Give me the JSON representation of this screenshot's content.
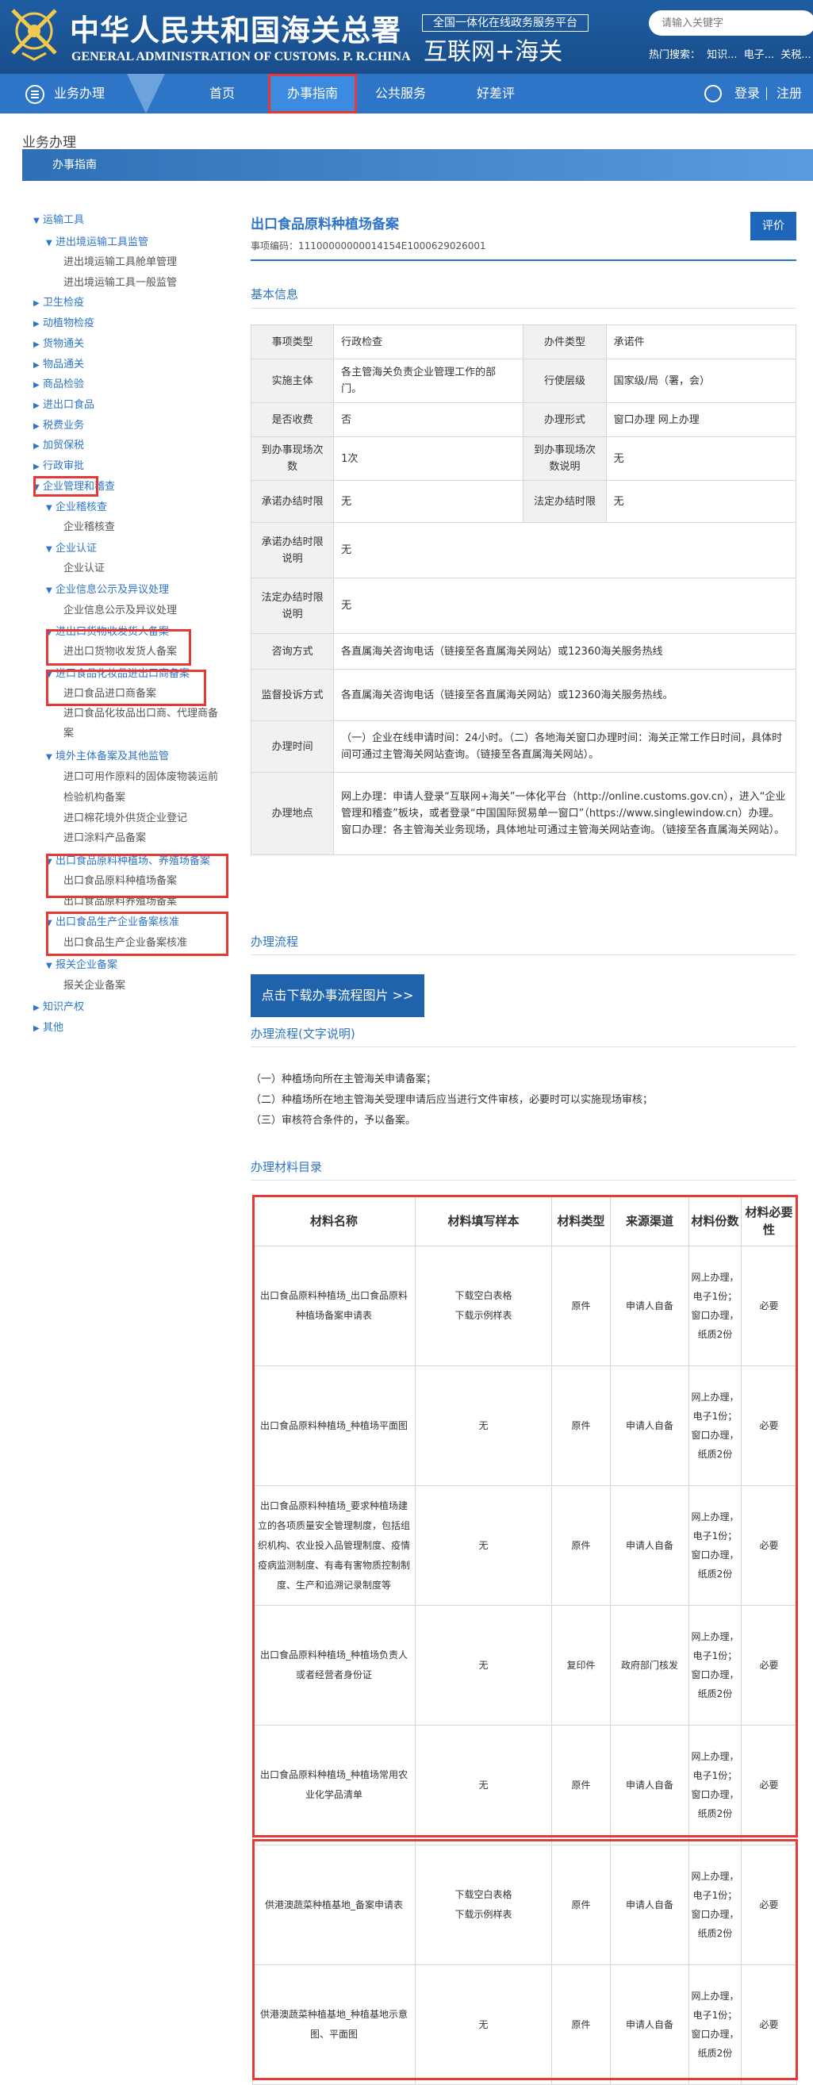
{
  "header": {
    "title_cn": "中华人民共和国海关总署",
    "title_en": "GENERAL ADMINISTRATION OF CUSTOMS. P. R.CHINA",
    "platform_tag": "全国一体化在线政务服务平台",
    "platform_name": "互联网+海关",
    "search_placeholder": "请输入关键字",
    "hot_search_label": "热门搜索：",
    "hot_search_items": [
      "知识...",
      "电子...",
      "关税..."
    ]
  },
  "nav": {
    "business": "业务办理",
    "home": "首页",
    "guide": "办事指南",
    "public_service": "公共服务",
    "review": "好差评",
    "login": "登录",
    "register": "注册"
  },
  "breadcrumb": "业务办理",
  "guide_bar_label": "办事指南",
  "sidebar": {
    "items": [
      {
        "label": "运输工具",
        "level": 0,
        "expanded": true
      },
      {
        "label": "进出境运输工具监管",
        "level": 1,
        "expanded": true
      },
      {
        "label": "进出境运输工具舱单管理",
        "level": 2
      },
      {
        "label": "进出境运输工具一般监管",
        "level": 2
      },
      {
        "label": "卫生检疫",
        "level": 0
      },
      {
        "label": "动植物检疫",
        "level": 0
      },
      {
        "label": "货物通关",
        "level": 0
      },
      {
        "label": "物品通关",
        "level": 0
      },
      {
        "label": "商品检验",
        "level": 0
      },
      {
        "label": "进出口食品",
        "level": 0
      },
      {
        "label": "税费业务",
        "level": 0
      },
      {
        "label": "加贸保税",
        "level": 0
      },
      {
        "label": "行政审批",
        "level": 0
      },
      {
        "label": "企业管理和稽查",
        "level": 0,
        "expanded": true
      },
      {
        "label": "企业稽核查",
        "level": 1,
        "expanded": true
      },
      {
        "label": "企业稽核查",
        "level": 2
      },
      {
        "label": "企业认证",
        "level": 1,
        "expanded": true
      },
      {
        "label": "企业认证",
        "level": 2
      },
      {
        "label": "企业信息公示及异议处理",
        "level": 1,
        "expanded": true
      },
      {
        "label": "企业信息公示及异议处理",
        "level": 2
      },
      {
        "label": "进出口货物收发货人备案",
        "level": 1,
        "expanded": true
      },
      {
        "label": "进出口货物收发货人备案",
        "level": 2
      },
      {
        "label": "进口食品化妆品进出口商备案",
        "level": 1,
        "expanded": true
      },
      {
        "label": "进口食品进口商备案",
        "level": 2
      },
      {
        "label": "进口食品化妆品出口商、代理商备",
        "level": 2
      },
      {
        "label": "案",
        "level": 2
      },
      {
        "label": "境外主体备案及其他监管",
        "level": 1,
        "expanded": true
      },
      {
        "label": "进口可用作原料的固体废物装运前",
        "level": 2
      },
      {
        "label": "检验机构备案",
        "level": 2
      },
      {
        "label": "进口棉花境外供货企业登记",
        "level": 2
      },
      {
        "label": "进口涂料产品备案",
        "level": 2
      },
      {
        "label": "出口食品原料种植场、养殖场备案",
        "level": 1,
        "expanded": true
      },
      {
        "label": "出口食品原料种植场备案",
        "level": 2
      },
      {
        "label": "出口食品原料养殖场备案",
        "level": 2
      },
      {
        "label": "出口食品生产企业备案核准",
        "level": 1,
        "expanded": true
      },
      {
        "label": "出口食品生产企业备案核准",
        "level": 2
      },
      {
        "label": "报关企业备案",
        "level": 1,
        "expanded": true
      },
      {
        "label": "报关企业备案",
        "level": 2
      },
      {
        "label": "知识产权",
        "level": 0
      },
      {
        "label": "其他",
        "level": 0
      }
    ]
  },
  "service": {
    "title": "出口食品原料种植场备案",
    "code_label": "事项编码：",
    "code": "11100000000014154E1000629026001",
    "eval_button": "评价"
  },
  "basic_info": {
    "heading": "基本信息",
    "rows": [
      {
        "k1": "事项类型",
        "v1": "行政检查",
        "k2": "办件类型",
        "v2": "承诺件"
      },
      {
        "k1": "实施主体",
        "v1": "各主管海关负责企业管理工作的部门。",
        "k2": "行使层级",
        "v2": "国家级/局（署，会）"
      },
      {
        "k1": "是否收费",
        "v1": "否",
        "k2": "办理形式",
        "v2": "窗口办理 网上办理"
      },
      {
        "k1": "到办事现场次数",
        "v1": "1次",
        "k2": "到办事现场次数说明",
        "v2": "无"
      },
      {
        "k1": "承诺办结时限",
        "v1": "无",
        "k2": "法定办结时限",
        "v2": "无"
      }
    ],
    "wide_rows": [
      {
        "k": "承诺办结时限说明",
        "v": "无"
      },
      {
        "k": "法定办结时限说明",
        "v": "无"
      },
      {
        "k": "咨询方式",
        "v": "各直属海关咨询电话（链接至各直属海关网站）或12360海关服务热线"
      },
      {
        "k": "监督投诉方式",
        "v": "各直属海关咨询电话（链接至各直属海关网站）或12360海关服务热线。"
      },
      {
        "k": "办理时间",
        "v": "（一）企业在线申请时间：24小时。（二）各地海关窗口办理时间：海关正常工作日时间，具体时间可通过主管海关网站查询。（链接至各直属海关网站）。"
      },
      {
        "k": "办理地点",
        "v": "网上办理：申请人登录“互联网+海关”一体化平台（http://online.customs.gov.cn），进入“企业管理和稽查”板块，或者登录“中国国际贸易单一窗口”（https://www.singlewindow.cn）办理。 窗口办理：各主管海关业务现场，具体地址可通过主管海关网站查询。（链接至各直属海关网站）。"
      }
    ]
  },
  "process": {
    "heading": "办理流程",
    "download_button": "点击下载办事流程图片 >>",
    "text_heading": "办理流程(文字说明)",
    "steps": [
      "（一）种植场向所在主管海关申请备案；",
      "（二）种植场所在地主管海关受理申请后应当进行文件审核，必要时可以实施现场审核；",
      "（三）审核符合条件的，予以备案。"
    ]
  },
  "materials": {
    "heading": "办理材料目录",
    "headers": [
      "材料名称",
      "材料填写样本",
      "材料类型",
      "来源渠道",
      "材料份数",
      "材料必要性"
    ],
    "sample_blank": "下载空白表格",
    "sample_example": "下载示例样表",
    "copies": "网上办理，电子1份；窗口办理，纸质2份",
    "rows": [
      {
        "name": "出口食品原料种植场_出口食品原料种植场备案申请表",
        "has_sample": true,
        "type": "原件",
        "source": "申请人自备",
        "required": "必要"
      },
      {
        "name": "出口食品原料种植场_种植场平面图",
        "has_sample": false,
        "sample": "无",
        "type": "原件",
        "source": "申请人自备",
        "required": "必要"
      },
      {
        "name": "出口食品原料种植场_要求种植场建立的各项质量安全管理制度，包括组织机构、农业投入品管理制度、疫情疫病监测制度、有毒有害物质控制制度、生产和追溯记录制度等",
        "has_sample": false,
        "sample": "无",
        "type": "原件",
        "source": "申请人自备",
        "required": "必要"
      },
      {
        "name": "出口食品原料种植场_种植场负责人或者经营者身份证",
        "has_sample": false,
        "sample": "无",
        "type": "复印件",
        "source": "政府部门核发",
        "required": "必要"
      },
      {
        "name": "出口食品原料种植场_种植场常用农业化学品清单",
        "has_sample": false,
        "sample": "无",
        "type": "原件",
        "source": "申请人自备",
        "required": "必要"
      },
      {
        "name": "供港澳蔬菜种植基地_备案申请表",
        "has_sample": true,
        "type": "原件",
        "source": "申请人自备",
        "required": "必要"
      },
      {
        "name": "供港澳蔬菜种植基地_种植基地示意图、平面图",
        "has_sample": false,
        "sample": "无",
        "type": "原件",
        "source": "申请人自备",
        "required": "必要"
      }
    ]
  },
  "colors": {
    "brand_blue": "#2e75c7",
    "header_blue": "#1f5ea3",
    "highlight_red": "#e53935"
  }
}
